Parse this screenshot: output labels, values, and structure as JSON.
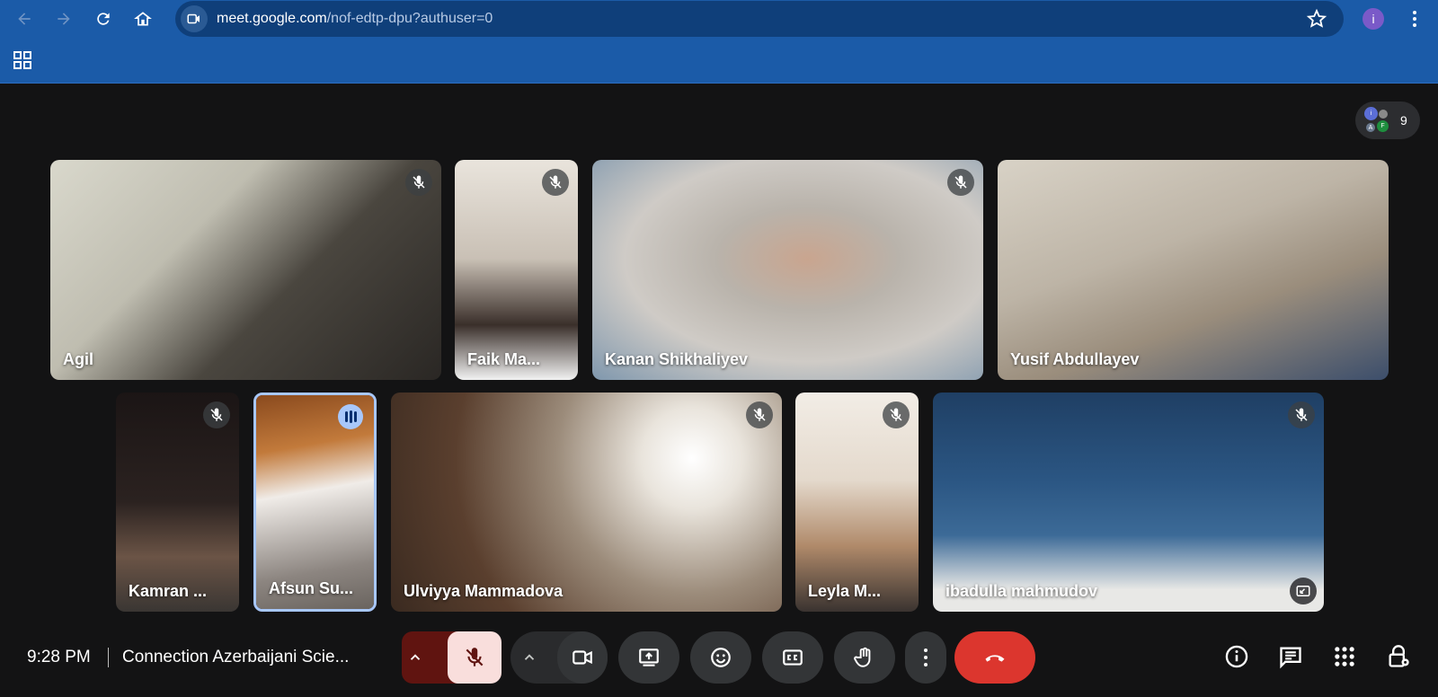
{
  "browser": {
    "url_host": "meet.google.com",
    "url_path": "/nof-edtp-dpu?authuser=0",
    "profile_initial": "i",
    "icons": [
      "back-icon",
      "forward-icon",
      "reload-icon",
      "home-icon",
      "video-site-icon",
      "star-icon",
      "kebab-icon",
      "apps-grid-icon"
    ]
  },
  "meet": {
    "participant_count": "9",
    "people_avatars": [
      "i",
      "",
      "A",
      "F"
    ],
    "tiles": [
      {
        "name": "Agil",
        "muted": true
      },
      {
        "name": "Faik Ma...",
        "muted": true
      },
      {
        "name": "Kanan Shikhaliyev",
        "muted": true
      },
      {
        "name": "Yusif Abdullayev",
        "muted": false
      },
      {
        "name": "Kamran ...",
        "muted": true
      },
      {
        "name": "Afsun Su...",
        "speaking": true
      },
      {
        "name": "Ulviyya Mammadova",
        "muted": true
      },
      {
        "name": "Leyla M...",
        "muted": true
      },
      {
        "name": "ibadulla mahmudov",
        "muted": true
      }
    ],
    "bottom": {
      "time": "9:28 PM",
      "meeting_title": "Connection Azerbaijani Scie...",
      "controls": [
        "mic-options",
        "mic-off",
        "camera-options",
        "camera",
        "present-screen",
        "reactions",
        "captions",
        "raise-hand",
        "more-options",
        "leave-call"
      ],
      "right_controls": [
        "meeting-details",
        "chat",
        "activities",
        "host-controls"
      ]
    },
    "colors": {
      "stage_bg": "#131314",
      "browser_bar": "#1b5ba8",
      "end_call": "#dc362e",
      "mic_off_bg": "#f9dedc",
      "speaking_border": "#a8c7fa"
    }
  }
}
